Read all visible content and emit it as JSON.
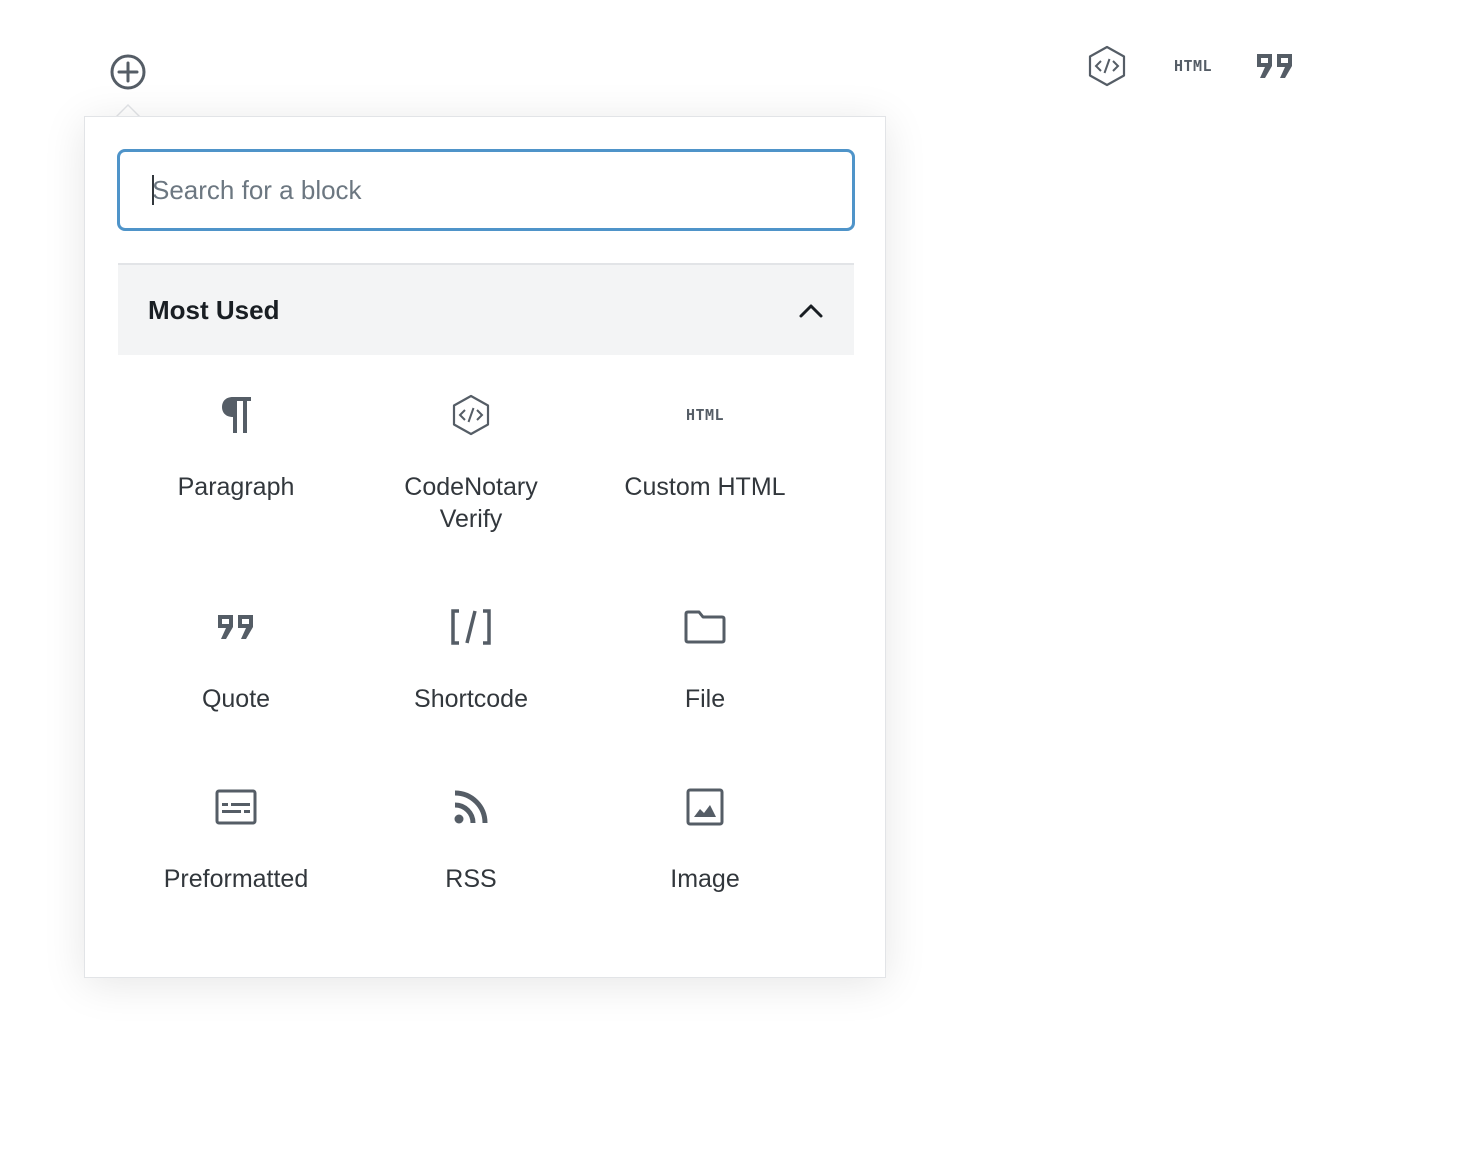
{
  "toolbar": {
    "add_block_icon": "plus-circle-icon",
    "shortcuts": [
      {
        "icon": "codenotary-icon",
        "label": "CodeNotary Verify"
      },
      {
        "icon": "html-icon",
        "glyph": "HTML",
        "label": "Custom HTML"
      },
      {
        "icon": "quote-icon",
        "label": "Quote"
      }
    ]
  },
  "inserter": {
    "search": {
      "placeholder": "Search for a block",
      "value": ""
    },
    "panel": {
      "title": "Most Used",
      "expanded": true
    },
    "blocks": [
      {
        "label": "Paragraph",
        "icon": "paragraph-icon"
      },
      {
        "label": "CodeNotary Verify",
        "icon": "codenotary-icon"
      },
      {
        "label": "Custom HTML",
        "icon": "html-icon",
        "glyph": "HTML"
      },
      {
        "label": "Quote",
        "icon": "quote-icon"
      },
      {
        "label": "Shortcode",
        "icon": "shortcode-icon",
        "glyph": "[/]"
      },
      {
        "label": "File",
        "icon": "folder-icon"
      },
      {
        "label": "Preformatted",
        "icon": "preformatted-icon"
      },
      {
        "label": "RSS",
        "icon": "rss-icon"
      },
      {
        "label": "Image",
        "icon": "image-icon"
      }
    ]
  },
  "colors": {
    "focus_border": "#4f94c9",
    "icon": "#555d66",
    "text": "#32373c",
    "panel_bg": "#f3f4f5"
  }
}
